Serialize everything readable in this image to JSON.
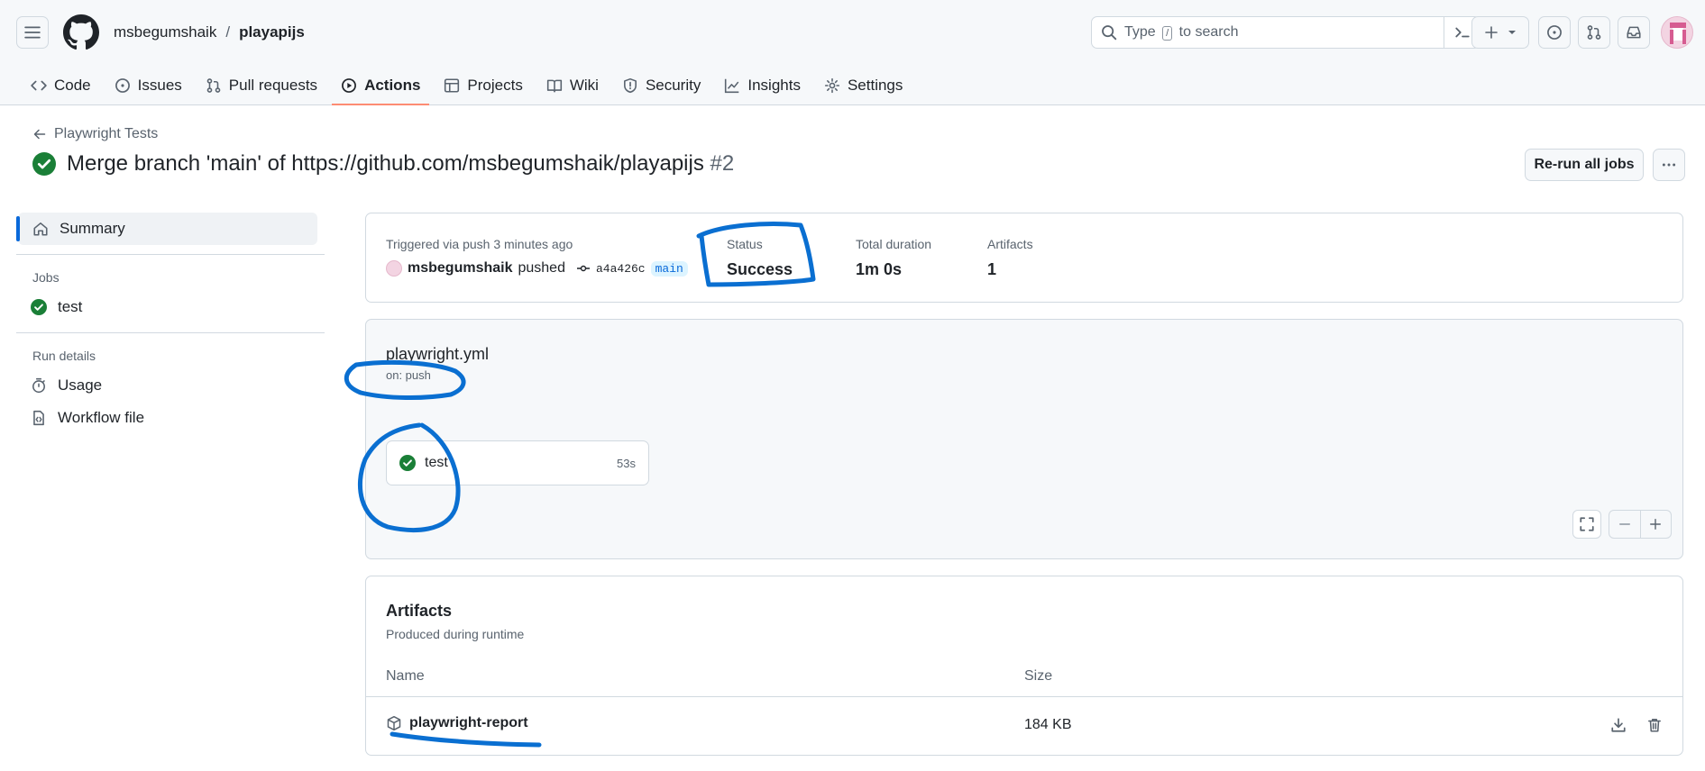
{
  "header": {
    "owner": "msbegumshaik",
    "separator": "/",
    "repo": "playapijs",
    "search": {
      "prefix": "Type",
      "key": "/",
      "suffix": "to search"
    }
  },
  "nav": {
    "tabs": [
      {
        "label": "Code",
        "icon": "code-icon",
        "active": false
      },
      {
        "label": "Issues",
        "icon": "issue-icon",
        "active": false
      },
      {
        "label": "Pull requests",
        "icon": "pull-request-icon",
        "active": false
      },
      {
        "label": "Actions",
        "icon": "play-icon",
        "active": true
      },
      {
        "label": "Projects",
        "icon": "table-icon",
        "active": false
      },
      {
        "label": "Wiki",
        "icon": "book-icon",
        "active": false
      },
      {
        "label": "Security",
        "icon": "shield-icon",
        "active": false
      },
      {
        "label": "Insights",
        "icon": "graph-icon",
        "active": false
      },
      {
        "label": "Settings",
        "icon": "gear-icon",
        "active": false
      }
    ]
  },
  "run": {
    "workflow_link": "Playwright Tests",
    "title": "Merge branch 'main' of https://github.com/msbegumshaik/playapijs",
    "number": "#2",
    "rerun_label": "Re-run all jobs"
  },
  "sidebar": {
    "summary_label": "Summary",
    "jobs_heading": "Jobs",
    "jobs": [
      {
        "label": "test",
        "status": "success"
      }
    ],
    "run_details_heading": "Run details",
    "details": [
      {
        "label": "Usage",
        "icon": "stopwatch-icon"
      },
      {
        "label": "Workflow file",
        "icon": "file-code-icon"
      }
    ]
  },
  "summary": {
    "trigger": "Triggered via push 3 minutes ago",
    "actor": "msbegumshaik",
    "action": "pushed",
    "sha": "a4a426c",
    "branch": "main",
    "status_label": "Status",
    "status_value": "Success",
    "duration_label": "Total duration",
    "duration_value": "1m 0s",
    "artifacts_label": "Artifacts",
    "artifacts_value": "1"
  },
  "workflow": {
    "file": "playwright.yml",
    "trigger": "on: push",
    "job": {
      "name": "test",
      "duration": "53s"
    }
  },
  "artifacts": {
    "title": "Artifacts",
    "subtitle": "Produced during runtime",
    "columns": {
      "name": "Name",
      "size": "Size"
    },
    "rows": [
      {
        "name": "playwright-report",
        "size": "184 KB"
      }
    ]
  },
  "colors": {
    "success": "#1a7f37",
    "accent": "#0969da",
    "active_tab_underline": "#fd8c73",
    "annotation": "#0a6fd1"
  }
}
